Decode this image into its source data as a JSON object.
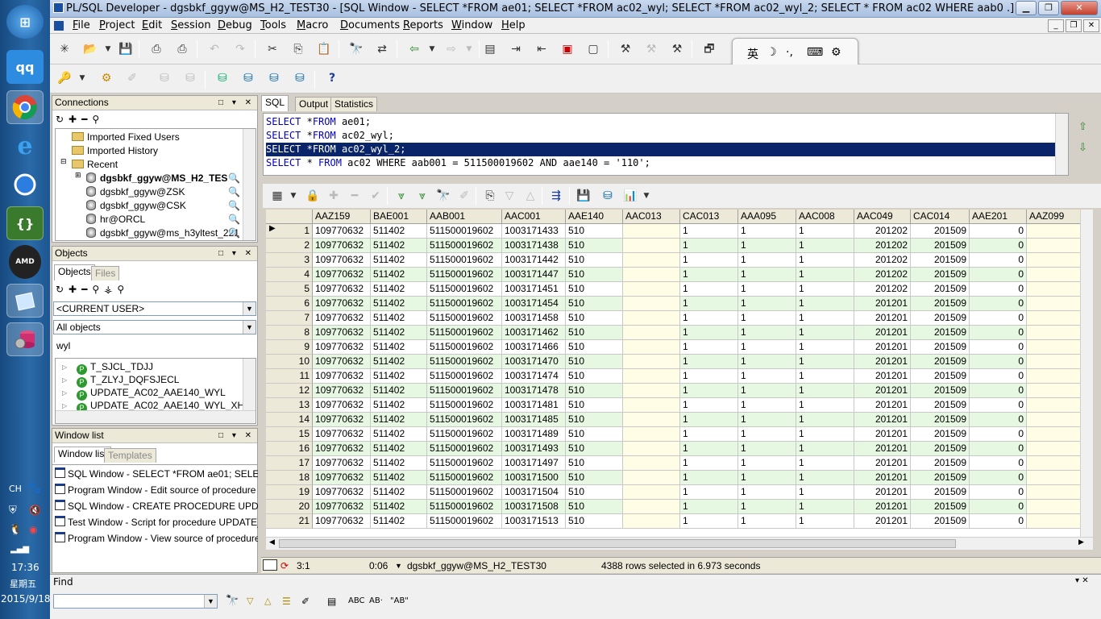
{
  "taskbar": {
    "icons": [
      "windows-start",
      "qq-app",
      "chrome",
      "internet-explorer",
      "browser-q",
      "brackets",
      "amd",
      "notepad",
      "db-tool"
    ],
    "tray": {
      "lang": "CH",
      "time": "17:36",
      "weekday": "星期五",
      "date": "2015/9/18"
    }
  },
  "window": {
    "title": "PL/SQL Developer - dgsbkf_ggyw@MS_H2_TEST30 - [SQL Window - SELECT *FROM ae01; SELECT *FROM ac02_wyl; SELECT *FROM ac02_wyl_2; SELECT * FROM ac02 WHERE aab0 .]"
  },
  "menu": [
    {
      "u": "F",
      "rest": "ile"
    },
    {
      "u": "P",
      "rest": "roject"
    },
    {
      "u": "E",
      "rest": "dit"
    },
    {
      "u": "S",
      "rest": "ession"
    },
    {
      "u": "D",
      "rest": "ebug"
    },
    {
      "u": "T",
      "rest": "ools"
    },
    {
      "u": "M",
      "rest": "acro"
    },
    {
      "u": "D",
      "rest": "ocuments"
    },
    {
      "u": "R",
      "rest": "eports"
    },
    {
      "u": "W",
      "rest": "indow"
    },
    {
      "u": "H",
      "rest": "elp"
    }
  ],
  "ime": {
    "lang": "英"
  },
  "connections": {
    "header": "Connections",
    "items": [
      {
        "label": "Imported Fixed Users",
        "type": "folder"
      },
      {
        "label": "Imported History",
        "type": "folder"
      },
      {
        "label": "Recent",
        "type": "folder"
      },
      {
        "label": "dgsbkf_ggyw@MS_H2_TES",
        "type": "db",
        "bold": true
      },
      {
        "label": "dgsbkf_ggyw@ZSK",
        "type": "db"
      },
      {
        "label": "dgsbkf_ggyw@CSK",
        "type": "db"
      },
      {
        "label": "hr@ORCL",
        "type": "db"
      },
      {
        "label": "dgsbkf_ggyw@ms_h3yltest_221",
        "type": "db"
      }
    ]
  },
  "objects": {
    "header": "Objects",
    "tabs": [
      "Objects",
      "Files"
    ],
    "user_select": "<CURRENT USER>",
    "type_select": "All objects",
    "filter": "wyl",
    "items": [
      "T_SJCL_TDJJ",
      "T_ZLYJ_DQFSJECL",
      "UPDATE_AC02_AAE140_WYL",
      "UPDATE_AC02_AAE140_WYL_XH"
    ]
  },
  "window_list": {
    "header": "Window list",
    "tabs": [
      "Window list",
      "Templates"
    ],
    "items": [
      "SQL Window - SELECT *FROM ae01; SELECT *F",
      "Program Window - Edit source of procedure DGSB",
      "SQL Window - CREATE PROCEDURE UPDATE_",
      "Test Window - Script for procedure UPDATE_AC0",
      "Program Window - View source of procedure DGSI"
    ]
  },
  "editor": {
    "tabs": [
      "SQL",
      "Output",
      "Statistics"
    ],
    "lines": [
      {
        "kw": "SELECT",
        "rest": " *",
        "kw2": "FROM",
        "tail": " ae01;"
      },
      {
        "kw": "SELECT",
        "rest": " *",
        "kw2": "FROM",
        "tail": " ac02_wyl;"
      },
      {
        "kw": "SELECT",
        "rest": " *",
        "kw2": "FROM",
        "tail": " ac02_wyl_2;"
      },
      {
        "kw": "SELECT",
        "rest": " * ",
        "kw2": "FROM",
        "tail": " ac02 WHERE aab001 = 511500019602 AND aae140 = '110';"
      }
    ]
  },
  "grid": {
    "columns": [
      "AAZ159",
      "BAE001",
      "AAB001",
      "AAC001",
      "AAE140",
      "AAC013",
      "CAC013",
      "AAA095",
      "AAC008",
      "AAC049",
      "CAC014",
      "AAE201",
      "AAZ099"
    ],
    "rows": [
      [
        "1",
        "109770632",
        "511402",
        "511500019602",
        "1003171433",
        "510",
        "",
        "1",
        "1",
        "1",
        "201202",
        "201509",
        "0"
      ],
      [
        "2",
        "109770632",
        "511402",
        "511500019602",
        "1003171438",
        "510",
        "",
        "1",
        "1",
        "1",
        "201202",
        "201509",
        "0"
      ],
      [
        "3",
        "109770632",
        "511402",
        "511500019602",
        "1003171442",
        "510",
        "",
        "1",
        "1",
        "1",
        "201202",
        "201509",
        "0"
      ],
      [
        "4",
        "109770632",
        "511402",
        "511500019602",
        "1003171447",
        "510",
        "",
        "1",
        "1",
        "1",
        "201202",
        "201509",
        "0"
      ],
      [
        "5",
        "109770632",
        "511402",
        "511500019602",
        "1003171451",
        "510",
        "",
        "1",
        "1",
        "1",
        "201202",
        "201509",
        "0"
      ],
      [
        "6",
        "109770632",
        "511402",
        "511500019602",
        "1003171454",
        "510",
        "",
        "1",
        "1",
        "1",
        "201201",
        "201509",
        "0"
      ],
      [
        "7",
        "109770632",
        "511402",
        "511500019602",
        "1003171458",
        "510",
        "",
        "1",
        "1",
        "1",
        "201201",
        "201509",
        "0"
      ],
      [
        "8",
        "109770632",
        "511402",
        "511500019602",
        "1003171462",
        "510",
        "",
        "1",
        "1",
        "1",
        "201201",
        "201509",
        "0"
      ],
      [
        "9",
        "109770632",
        "511402",
        "511500019602",
        "1003171466",
        "510",
        "",
        "1",
        "1",
        "1",
        "201201",
        "201509",
        "0"
      ],
      [
        "10",
        "109770632",
        "511402",
        "511500019602",
        "1003171470",
        "510",
        "",
        "1",
        "1",
        "1",
        "201201",
        "201509",
        "0"
      ],
      [
        "11",
        "109770632",
        "511402",
        "511500019602",
        "1003171474",
        "510",
        "",
        "1",
        "1",
        "1",
        "201201",
        "201509",
        "0"
      ],
      [
        "12",
        "109770632",
        "511402",
        "511500019602",
        "1003171478",
        "510",
        "",
        "1",
        "1",
        "1",
        "201201",
        "201509",
        "0"
      ],
      [
        "13",
        "109770632",
        "511402",
        "511500019602",
        "1003171481",
        "510",
        "",
        "1",
        "1",
        "1",
        "201201",
        "201509",
        "0"
      ],
      [
        "14",
        "109770632",
        "511402",
        "511500019602",
        "1003171485",
        "510",
        "",
        "1",
        "1",
        "1",
        "201201",
        "201509",
        "0"
      ],
      [
        "15",
        "109770632",
        "511402",
        "511500019602",
        "1003171489",
        "510",
        "",
        "1",
        "1",
        "1",
        "201201",
        "201509",
        "0"
      ],
      [
        "16",
        "109770632",
        "511402",
        "511500019602",
        "1003171493",
        "510",
        "",
        "1",
        "1",
        "1",
        "201201",
        "201509",
        "0"
      ],
      [
        "17",
        "109770632",
        "511402",
        "511500019602",
        "1003171497",
        "510",
        "",
        "1",
        "1",
        "1",
        "201201",
        "201509",
        "0"
      ],
      [
        "18",
        "109770632",
        "511402",
        "511500019602",
        "1003171500",
        "510",
        "",
        "1",
        "1",
        "1",
        "201201",
        "201509",
        "0"
      ],
      [
        "19",
        "109770632",
        "511402",
        "511500019602",
        "1003171504",
        "510",
        "",
        "1",
        "1",
        "1",
        "201201",
        "201509",
        "0"
      ],
      [
        "20",
        "109770632",
        "511402",
        "511500019602",
        "1003171508",
        "510",
        "",
        "1",
        "1",
        "1",
        "201201",
        "201509",
        "0"
      ],
      [
        "21",
        "109770632",
        "511402",
        "511500019602",
        "1003171513",
        "510",
        "",
        "1",
        "1",
        "1",
        "201201",
        "201509",
        "0"
      ]
    ]
  },
  "status": {
    "position": "3:1",
    "time": "0:06",
    "connection": "dgsbkf_ggyw@MS_H2_TEST30",
    "message": "4388 rows selected in 6.973 seconds"
  },
  "find": {
    "label": "Find",
    "buttons": [
      "ABC",
      "AB·",
      "\"AB\""
    ]
  },
  "colors": {
    "row_alt": "#e6f7e2",
    "selection": "#0a246a",
    "highlight_col": "#fffde6"
  }
}
